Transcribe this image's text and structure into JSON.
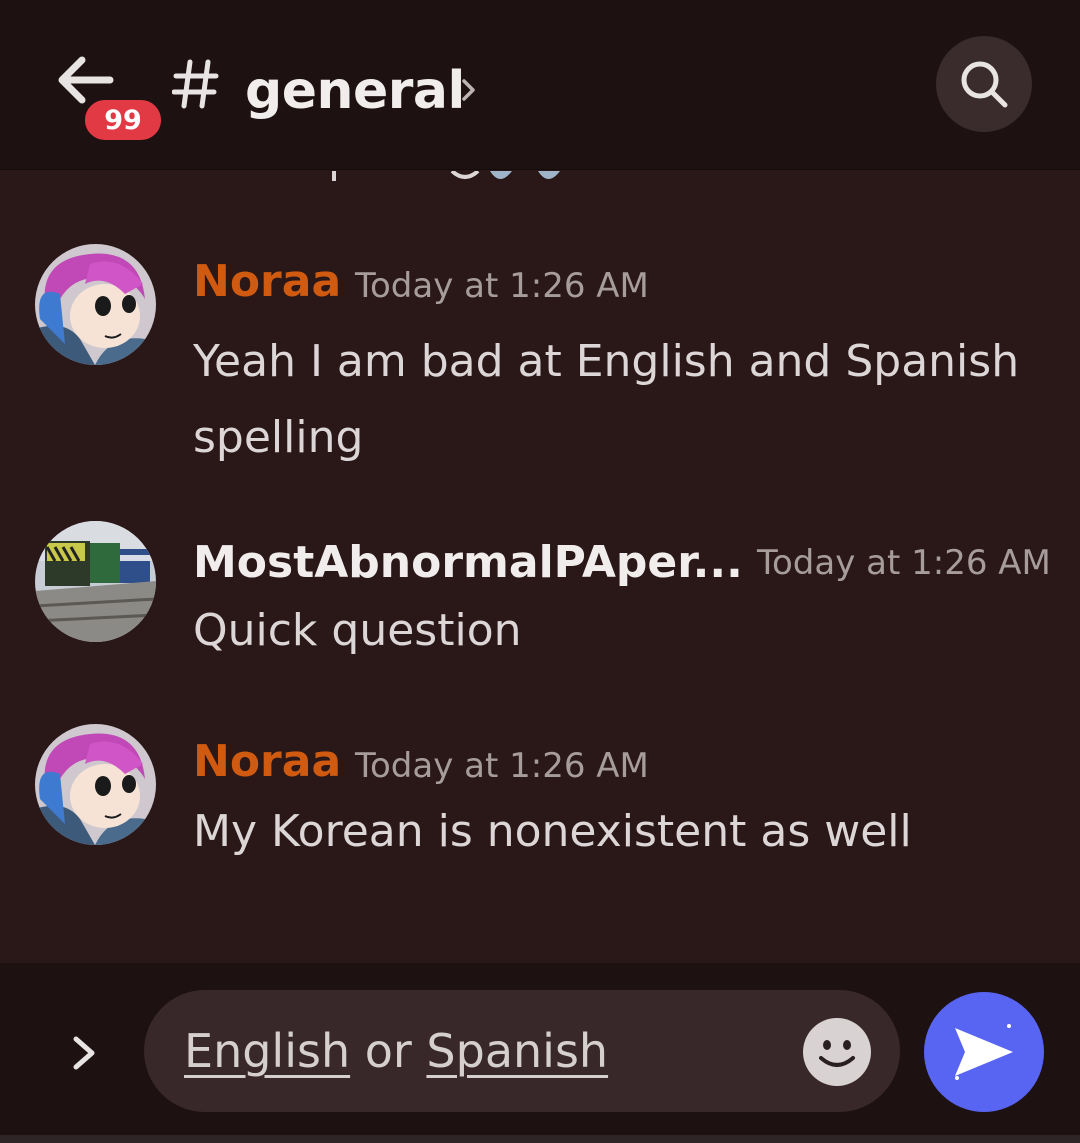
{
  "header": {
    "unread_count": "99",
    "channel_prefix": "#",
    "channel_name": "general"
  },
  "messages": [
    {
      "author": "Noraa",
      "author_color": "#cf5a10",
      "timestamp": "Today at 1:26 AM",
      "text": "Yeah I am bad at English and Spanish spelling"
    },
    {
      "author": "MostAbnormalPAper...",
      "author_color": "#f2eded",
      "timestamp": "Today at 1:26 AM",
      "text": "Quick question"
    },
    {
      "author": "Noraa",
      "author_color": "#cf5a10",
      "timestamp": "Today at 1:26 AM",
      "text": "My Korean is nonexistent as well"
    }
  ],
  "composer": {
    "word1": "English",
    "word2": "or",
    "word3": "Spanish"
  },
  "colors": {
    "background": "#2a1718",
    "header": "#1d1112",
    "badge": "#e23a45",
    "send_button": "#5865f2"
  },
  "icons": {
    "back": "back-arrow-icon",
    "channel": "hash-icon",
    "chevron": "chevron-right-icon",
    "search": "search-icon",
    "expand": "chevron-right-icon",
    "emoji": "emoji-icon",
    "send": "send-icon"
  }
}
